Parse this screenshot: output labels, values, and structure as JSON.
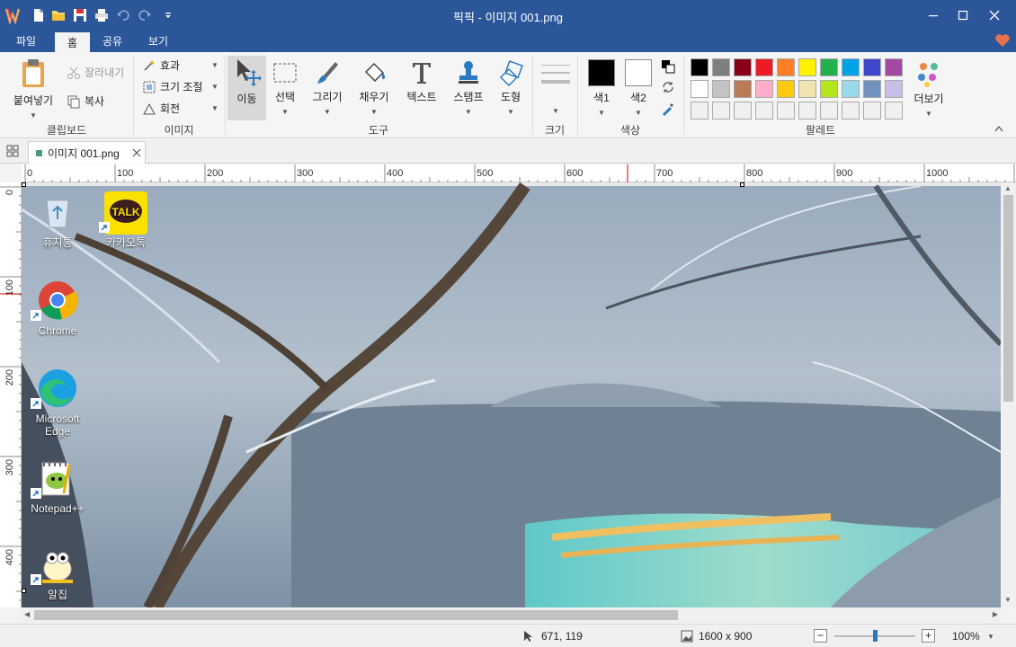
{
  "window": {
    "title": "픽픽 - 이미지 001.png"
  },
  "menu_tabs": [
    "파일",
    "홈",
    "공유",
    "보기"
  ],
  "active_tab": "홈",
  "ribbon": {
    "clipboard": {
      "paste": "붙여넣기",
      "cut": "잘라내기",
      "copy": "복사",
      "group": "클립보드"
    },
    "image": {
      "effects": "효과",
      "resize": "크기 조절",
      "rotate": "회전",
      "group": "이미지"
    },
    "tools": {
      "move": "이동",
      "select": "선택",
      "draw": "그리기",
      "fill": "채우기",
      "text": "텍스트",
      "stamp": "스탬프",
      "shape": "도형",
      "group": "도구"
    },
    "size": {
      "group": "크기"
    },
    "color": {
      "color1": "색1",
      "color2": "색2",
      "group": "색상"
    },
    "palette": {
      "group": "팔레트",
      "more": "더보기",
      "row1": [
        "#000000",
        "#7f7f7f",
        "#880015",
        "#ed1c24",
        "#ff7f27",
        "#fff200",
        "#22b14c",
        "#00a2e8",
        "#3f48cc",
        "#a349a4"
      ],
      "row2": [
        "#ffffff",
        "#c3c3c3",
        "#b97a57",
        "#ffaec9",
        "#ffc90e",
        "#efe4b0",
        "#b5e61d",
        "#99d9ea",
        "#7092be",
        "#c8bfe7"
      ],
      "row3": [
        "#f0f0f0",
        "#f0f0f0",
        "#f0f0f0",
        "#f0f0f0",
        "#f0f0f0",
        "#f0f0f0",
        "#f0f0f0",
        "#f0f0f0",
        "#f0f0f0",
        "#f0f0f0"
      ]
    }
  },
  "doc_tab": {
    "name": "이미지 001.png"
  },
  "ruler": {
    "h_labels": [
      "0",
      "100",
      "200",
      "300",
      "400",
      "500",
      "600",
      "700",
      "800",
      "900",
      "1000"
    ],
    "v_labels": [
      "0",
      "100",
      "200",
      "300",
      "400"
    ]
  },
  "desktop_icons": [
    {
      "label": "휴지통",
      "icon": "recycle-bin-icon"
    },
    {
      "label": "카카오톡",
      "icon": "kakaotalk-icon",
      "badge": "TALK"
    },
    {
      "label": "Chrome",
      "icon": "chrome-icon"
    },
    {
      "label": "Microsoft Edge",
      "icon": "edge-icon"
    },
    {
      "label": "Notepad++",
      "icon": "notepad-plus-icon"
    },
    {
      "label": "알집",
      "icon": "alzip-icon"
    }
  ],
  "status": {
    "cursor_pos": "671, 119",
    "image_size": "1600 x 900",
    "zoom": "100%",
    "zoom_slider_fraction": 0.5
  },
  "colors": {
    "titlebar": "#2b579a",
    "accent_heart": "#e8734a"
  }
}
